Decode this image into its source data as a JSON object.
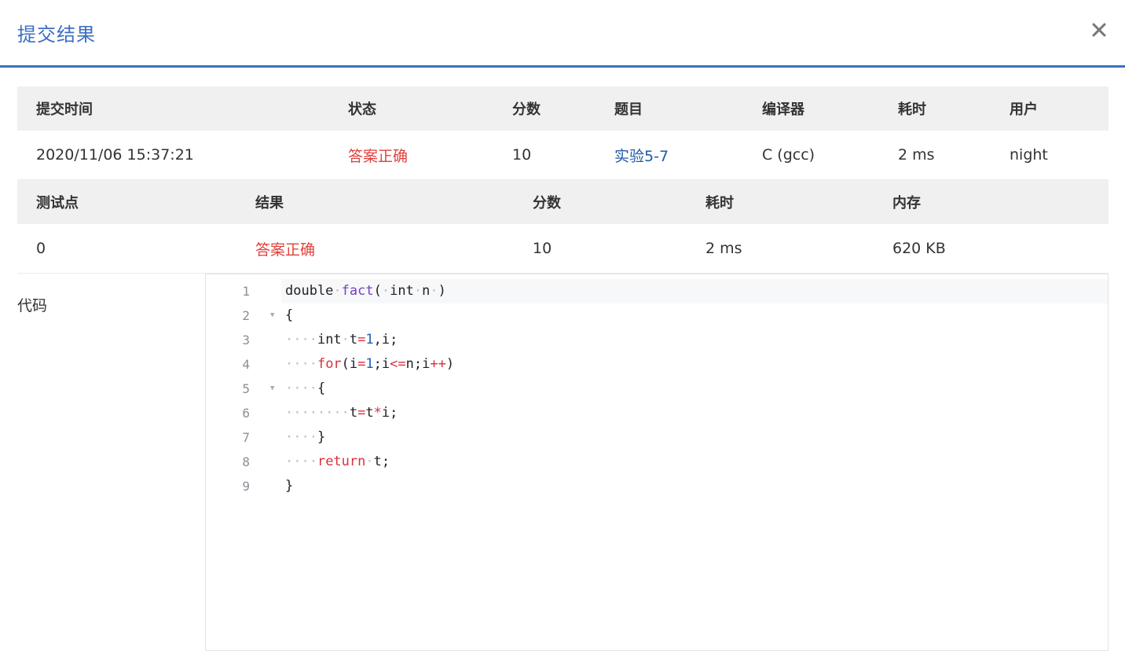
{
  "header": {
    "title": "提交结果"
  },
  "colors": {
    "accent": "#3b6fc4",
    "correct": "#e0413c",
    "link": "#1f5aa6"
  },
  "submission_table": {
    "columns": [
      "提交时间",
      "状态",
      "分数",
      "题目",
      "编译器",
      "耗时",
      "用户"
    ],
    "row": {
      "time": "2020/11/06 15:37:21",
      "status": "答案正确",
      "score": "10",
      "problem": "实验5-7",
      "compiler": "C (gcc)",
      "elapsed": "2 ms",
      "user": "night"
    }
  },
  "testcase_table": {
    "columns": [
      "测试点",
      "结果",
      "分数",
      "耗时",
      "内存"
    ],
    "row": {
      "id": "0",
      "result": "答案正确",
      "score": "10",
      "elapsed": "2 ms",
      "memory": "620 KB"
    }
  },
  "code": {
    "label": "代码",
    "lines": [
      {
        "num": "1",
        "fold": false
      },
      {
        "num": "2",
        "fold": true
      },
      {
        "num": "3",
        "fold": false
      },
      {
        "num": "4",
        "fold": false
      },
      {
        "num": "5",
        "fold": true
      },
      {
        "num": "6",
        "fold": false
      },
      {
        "num": "7",
        "fold": false
      },
      {
        "num": "8",
        "fold": false
      },
      {
        "num": "9",
        "fold": false
      }
    ],
    "tokens": {
      "l1_double": "double",
      "l1_fact": "fact",
      "l1_paren": "(",
      "l1_int": "int",
      "l1_n": "n",
      "l1_close": ")",
      "l2_brace": "{",
      "l3_int": "int",
      "l3_t": "t",
      "l3_eq": "=",
      "l3_one": "1",
      "l3_rest": ",i;",
      "l4_for": "for",
      "l4_a": "(i",
      "l4_eq": "=",
      "l4_one": "1",
      "l4_b": ";i",
      "l4_le": "<=",
      "l4_c": "n;i",
      "l4_pp": "++",
      "l4_d": ")",
      "l5_brace": "{",
      "l6_t": "t",
      "l6_eq": "=",
      "l6_t2": "t",
      "l6_mul": "*",
      "l6_rest": "i;",
      "l7_brace": "}",
      "l8_return": "return",
      "l8_rest": "t;",
      "l9_brace": "}"
    },
    "fold_icon": "triangle-down-icon"
  },
  "icons": {
    "close": "close-icon"
  }
}
